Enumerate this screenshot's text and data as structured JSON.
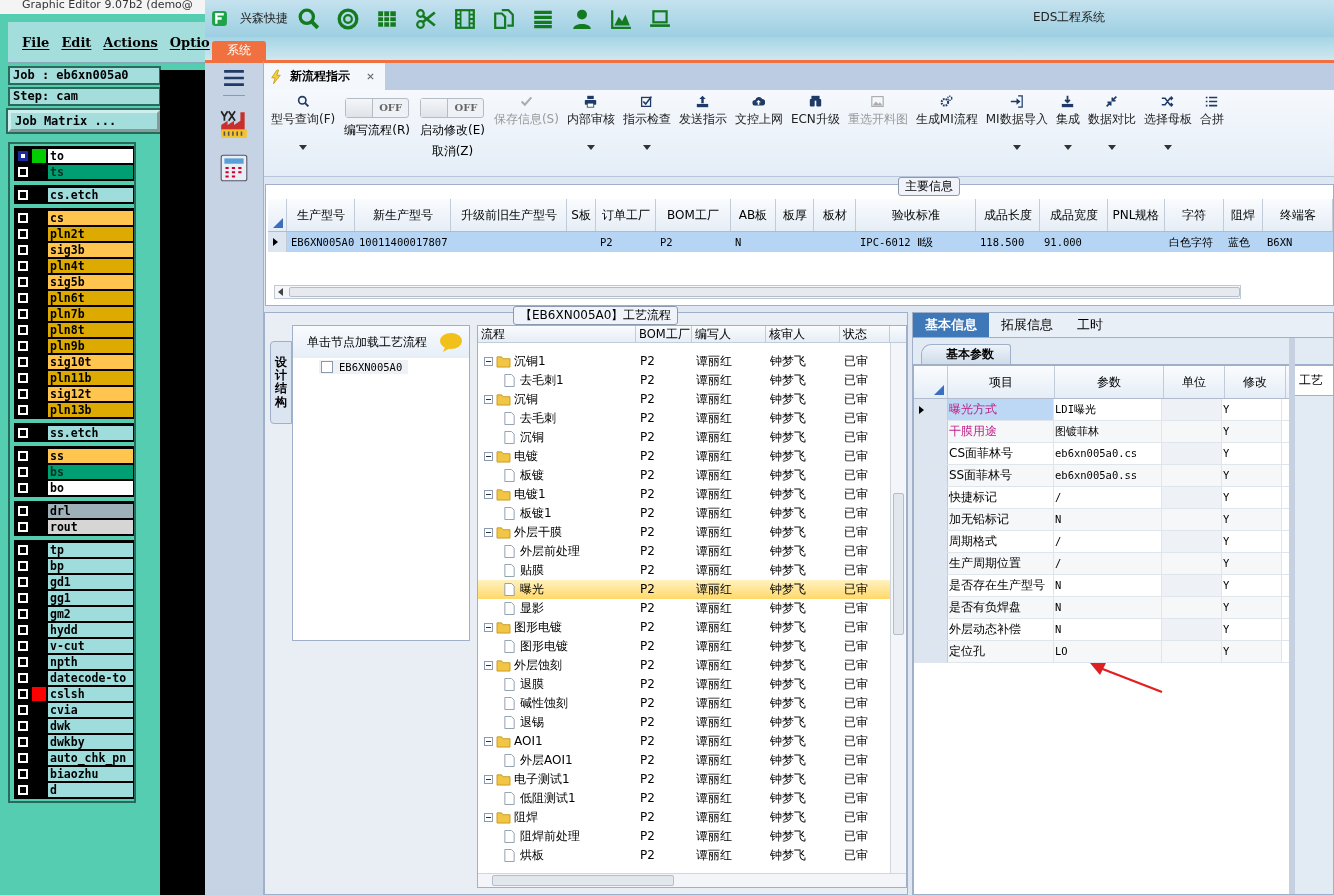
{
  "editor": {
    "title": "Graphic Editor 9.07b2 (demo@",
    "menu": [
      "File",
      "Edit",
      "Actions",
      "Optio"
    ],
    "job": "Job : eb6xn005a0",
    "step": "Step: cam",
    "matrix_button": "Job Matrix ...",
    "layer_groups": [
      [
        {
          "name": "to",
          "color": "#ffffff",
          "selected": true,
          "marker": {
            "color": "#00cc00"
          }
        },
        {
          "name": "ts",
          "color": "#009e73",
          "selected": false
        }
      ],
      [
        {
          "name": "cs.etch",
          "color": "#9fdcdc",
          "selected": false
        }
      ],
      [
        {
          "name": "cs",
          "color": "#ffc54f",
          "selected": false
        },
        {
          "name": "pln2t",
          "color": "#dcaa00",
          "selected": false
        },
        {
          "name": "sig3b",
          "color": "#ffc54f",
          "selected": false
        },
        {
          "name": "pln4t",
          "color": "#dcaa00",
          "selected": false
        },
        {
          "name": "sig5b",
          "color": "#ffc54f",
          "selected": false
        },
        {
          "name": "pln6t",
          "color": "#dcaa00",
          "selected": false
        },
        {
          "name": "pln7b",
          "color": "#dcaa00",
          "selected": false
        },
        {
          "name": "pln8t",
          "color": "#dcaa00",
          "selected": false
        },
        {
          "name": "pln9b",
          "color": "#dcaa00",
          "selected": false
        },
        {
          "name": "sig10t",
          "color": "#ffc54f",
          "selected": false
        },
        {
          "name": "pln11b",
          "color": "#dcaa00",
          "selected": false
        },
        {
          "name": "sig12t",
          "color": "#ffc54f",
          "selected": false
        },
        {
          "name": "pln13b",
          "color": "#dcaa00",
          "selected": false
        }
      ],
      [
        {
          "name": "ss.etch",
          "color": "#9fdcdc",
          "selected": false
        }
      ],
      [
        {
          "name": "ss",
          "color": "#ffc54f",
          "selected": false
        },
        {
          "name": "bs",
          "color": "#009e73",
          "selected": false
        },
        {
          "name": "bo",
          "color": "#ffffff",
          "selected": false
        }
      ],
      [
        {
          "name": "drl",
          "color": "#9eb0b8",
          "selected": false
        },
        {
          "name": "rout",
          "color": "#d6d6d6",
          "selected": false
        }
      ],
      [
        {
          "name": "tp",
          "color": "#9fdcdc",
          "selected": false
        },
        {
          "name": "bp",
          "color": "#9fdcdc",
          "selected": false
        },
        {
          "name": "gd1",
          "color": "#9fdcdc",
          "selected": false
        },
        {
          "name": "gg1",
          "color": "#9fdcdc",
          "selected": false
        },
        {
          "name": "gm2",
          "color": "#9fdcdc",
          "selected": false
        },
        {
          "name": "hydd",
          "color": "#9fdcdc",
          "selected": false
        },
        {
          "name": "v-cut",
          "color": "#9fdcdc",
          "selected": false
        },
        {
          "name": "npth",
          "color": "#9fdcdc",
          "selected": false
        },
        {
          "name": "datecode-to",
          "color": "#9fdcdc",
          "selected": false
        },
        {
          "name": "cslsh",
          "color": "#9fdcdc",
          "selected": false,
          "marker": {
            "color": "#ff0000"
          }
        },
        {
          "name": "cvia",
          "color": "#9fdcdc",
          "selected": false
        },
        {
          "name": "dwk",
          "color": "#9fdcdc",
          "selected": false
        },
        {
          "name": "dwkby",
          "color": "#9fdcdc",
          "selected": false
        },
        {
          "name": "auto_chk_pn",
          "color": "#9fdcdc",
          "selected": false
        },
        {
          "name": "biaozhu",
          "color": "#9fdcdc",
          "selected": false
        },
        {
          "name": "d",
          "color": "#9fdcdc",
          "selected": false
        }
      ]
    ]
  },
  "app": {
    "brand": "兴森快捷",
    "title": "EDS工程系统",
    "system_tab": "系统",
    "doc_tab": {
      "label": "新流程指示",
      "selected": true
    }
  },
  "ribbon": [
    {
      "kind": "button",
      "label": "型号查询(F)",
      "disabled": false,
      "dropdown": true
    },
    {
      "kind": "toggle",
      "label": "编写流程(R)",
      "state": "OFF",
      "on": false
    },
    {
      "kind": "toggle",
      "label": "启动修改(E)",
      "state": "OFF",
      "on": false,
      "sublabel": "取消(Z)"
    },
    {
      "kind": "button",
      "label": "保存信息(S)",
      "disabled": true,
      "dropdown": false
    },
    {
      "kind": "button",
      "label": "内部审核",
      "disabled": false,
      "dropdown": true
    },
    {
      "kind": "button",
      "label": "指示检查",
      "disabled": false,
      "dropdown": true
    },
    {
      "kind": "button",
      "label": "发送指示",
      "disabled": false,
      "dropdown": false
    },
    {
      "kind": "button",
      "label": "文控上网",
      "disabled": false,
      "dropdown": false
    },
    {
      "kind": "button",
      "label": "ECN升级",
      "disabled": false,
      "dropdown": false
    },
    {
      "kind": "button",
      "label": "重选开料图",
      "disabled": true,
      "dropdown": false
    },
    {
      "kind": "button",
      "label": "生成MI流程",
      "disabled": false,
      "dropdown": false
    },
    {
      "kind": "button",
      "label": "MI数据导入",
      "disabled": false,
      "dropdown": true
    },
    {
      "kind": "button",
      "label": "集成",
      "disabled": false,
      "dropdown": true
    },
    {
      "kind": "button",
      "label": "数据对比",
      "disabled": false,
      "dropdown": true
    },
    {
      "kind": "button",
      "label": "选择母板",
      "disabled": false,
      "dropdown": true
    },
    {
      "kind": "button",
      "label": "合拼",
      "disabled": false,
      "dropdown": false
    }
  ],
  "main_info": {
    "legend": "主要信息",
    "columns": [
      "生产型号",
      "新生产型号",
      "升级前旧生产型号",
      "S板",
      "订单工厂",
      "BOM工厂",
      "AB板",
      "板厚",
      "板材",
      "验收标准",
      "成品长度",
      "成品宽度",
      "PNL规格",
      "字符",
      "阻焊",
      "终端客"
    ],
    "rows": [
      {
        "selected": true,
        "cells": [
          "EB6XN005A0",
          "10011400017807",
          null,
          null,
          "P2",
          "P2",
          "N",
          null,
          null,
          "IPC-6012 Ⅱ级",
          "118.500",
          "91.000",
          null,
          "白色字符",
          "蓝色",
          "B6XN"
        ]
      }
    ]
  },
  "flow": {
    "legend": "【EB6XN005A0】工艺流程",
    "side_tab": "设计结构",
    "loader": {
      "hint": "单击节点加载工艺流程",
      "nodes": [
        {
          "label": "EB6XN005A0",
          "checked": false
        }
      ]
    },
    "columns": [
      "流程",
      "BOM工厂",
      "编写人",
      "核审人",
      "状态"
    ],
    "steps": [
      {
        "name": "沉铜1",
        "factory": "P2",
        "writer": "谭丽红",
        "reviewer": "钟梦飞",
        "status": "已审",
        "expanded": true,
        "selected": false,
        "children": [
          {
            "name": "去毛刺1",
            "factory": "P2",
            "writer": "谭丽红",
            "reviewer": "钟梦飞",
            "status": "已审",
            "selected": false
          }
        ]
      },
      {
        "name": "沉铜",
        "factory": "P2",
        "writer": "谭丽红",
        "reviewer": "钟梦飞",
        "status": "已审",
        "expanded": true,
        "selected": false,
        "children": [
          {
            "name": "去毛刺",
            "factory": "P2",
            "writer": "谭丽红",
            "reviewer": "钟梦飞",
            "status": "已审",
            "selected": false
          },
          {
            "name": "沉铜",
            "factory": "P2",
            "writer": "谭丽红",
            "reviewer": "钟梦飞",
            "status": "已审",
            "selected": false
          }
        ]
      },
      {
        "name": "电镀",
        "factory": "P2",
        "writer": "谭丽红",
        "reviewer": "钟梦飞",
        "status": "已审",
        "expanded": true,
        "selected": false,
        "children": [
          {
            "name": "板镀",
            "factory": "P2",
            "writer": "谭丽红",
            "reviewer": "钟梦飞",
            "status": "已审",
            "selected": false
          }
        ]
      },
      {
        "name": "电镀1",
        "factory": "P2",
        "writer": "谭丽红",
        "reviewer": "钟梦飞",
        "status": "已审",
        "expanded": true,
        "selected": false,
        "children": [
          {
            "name": "板镀1",
            "factory": "P2",
            "writer": "谭丽红",
            "reviewer": "钟梦飞",
            "status": "已审",
            "selected": false
          }
        ]
      },
      {
        "name": "外层干膜",
        "factory": "P2",
        "writer": "谭丽红",
        "reviewer": "钟梦飞",
        "status": "已审",
        "expanded": true,
        "selected": false,
        "children": [
          {
            "name": "外层前处理",
            "factory": "P2",
            "writer": "谭丽红",
            "reviewer": "钟梦飞",
            "status": "已审",
            "selected": false
          },
          {
            "name": "贴膜",
            "factory": "P2",
            "writer": "谭丽红",
            "reviewer": "钟梦飞",
            "status": "已审",
            "selected": false
          },
          {
            "name": "曝光",
            "factory": "P2",
            "writer": "谭丽红",
            "reviewer": "钟梦飞",
            "status": "已审",
            "selected": true
          },
          {
            "name": "显影",
            "factory": "P2",
            "writer": "谭丽红",
            "reviewer": "钟梦飞",
            "status": "已审",
            "selected": false
          }
        ]
      },
      {
        "name": "图形电镀",
        "factory": "P2",
        "writer": "谭丽红",
        "reviewer": "钟梦飞",
        "status": "已审",
        "expanded": true,
        "selected": false,
        "children": [
          {
            "name": "图形电镀",
            "factory": "P2",
            "writer": "谭丽红",
            "reviewer": "钟梦飞",
            "status": "已审",
            "selected": false
          }
        ]
      },
      {
        "name": "外层蚀刻",
        "factory": "P2",
        "writer": "谭丽红",
        "reviewer": "钟梦飞",
        "status": "已审",
        "expanded": true,
        "selected": false,
        "children": [
          {
            "name": "退膜",
            "factory": "P2",
            "writer": "谭丽红",
            "reviewer": "钟梦飞",
            "status": "已审",
            "selected": false
          },
          {
            "name": "碱性蚀刻",
            "factory": "P2",
            "writer": "谭丽红",
            "reviewer": "钟梦飞",
            "status": "已审",
            "selected": false
          },
          {
            "name": "退锡",
            "factory": "P2",
            "writer": "谭丽红",
            "reviewer": "钟梦飞",
            "status": "已审",
            "selected": false
          }
        ]
      },
      {
        "name": "AOI1",
        "factory": "P2",
        "writer": "谭丽红",
        "reviewer": "钟梦飞",
        "status": "已审",
        "expanded": true,
        "selected": false,
        "children": [
          {
            "name": "外层AOI1",
            "factory": "P2",
            "writer": "谭丽红",
            "reviewer": "钟梦飞",
            "status": "已审",
            "selected": false
          }
        ]
      },
      {
        "name": "电子测试1",
        "factory": "P2",
        "writer": "谭丽红",
        "reviewer": "钟梦飞",
        "status": "已审",
        "expanded": true,
        "selected": false,
        "children": [
          {
            "name": "低阻测试1",
            "factory": "P2",
            "writer": "谭丽红",
            "reviewer": "钟梦飞",
            "status": "已审",
            "selected": false
          }
        ]
      },
      {
        "name": "阻焊",
        "factory": "P2",
        "writer": "谭丽红",
        "reviewer": "钟梦飞",
        "status": "已审",
        "expanded": true,
        "selected": false,
        "children": [
          {
            "name": "阻焊前处理",
            "factory": "P2",
            "writer": "谭丽红",
            "reviewer": "钟梦飞",
            "status": "已审",
            "selected": false
          },
          {
            "name": "烘板",
            "factory": "P2",
            "writer": "谭丽红",
            "reviewer": "钟梦飞",
            "status": "已审",
            "selected": false
          }
        ]
      }
    ]
  },
  "params": {
    "tabs": [
      {
        "label": "基本信息",
        "selected": true
      },
      {
        "label": "拓展信息",
        "selected": false
      },
      {
        "label": "工时",
        "selected": false
      }
    ],
    "subtab": "基本参数",
    "columns": [
      "项目",
      "参数",
      "单位",
      "修改"
    ],
    "rows": [
      {
        "item": "曝光方式",
        "value": "LDI曝光",
        "modify": "Y",
        "required": true,
        "selected": true
      },
      {
        "item": "干膜用途",
        "value": "图镀菲林",
        "modify": "Y",
        "required": true,
        "selected": false
      },
      {
        "item": "CS面菲林号",
        "value": "eb6xn005a0.cs",
        "modify": "Y",
        "required": false,
        "selected": false
      },
      {
        "item": "SS面菲林号",
        "value": "eb6xn005a0.ss",
        "modify": "Y",
        "required": false,
        "selected": false
      },
      {
        "item": "快捷标记",
        "value": "/",
        "modify": "Y",
        "required": false,
        "selected": false
      },
      {
        "item": "加无铅标记",
        "value": "N",
        "modify": "Y",
        "required": false,
        "selected": false
      },
      {
        "item": "周期格式",
        "value": "/",
        "modify": "Y",
        "required": false,
        "selected": false
      },
      {
        "item": "生产周期位置",
        "value": "/",
        "modify": "Y",
        "required": false,
        "selected": false
      },
      {
        "item": "是否存在生产型号",
        "value": "N",
        "modify": "Y",
        "required": false,
        "selected": false
      },
      {
        "item": "是否有负焊盘",
        "value": "N",
        "modify": "Y",
        "required": false,
        "selected": false
      },
      {
        "item": "外层动态补偿",
        "value": "N",
        "modify": "Y",
        "required": false,
        "selected": false
      },
      {
        "item": "定位孔",
        "value": "LO",
        "modify": "Y",
        "required": false,
        "selected": false
      }
    ],
    "side_tab": "工艺"
  }
}
